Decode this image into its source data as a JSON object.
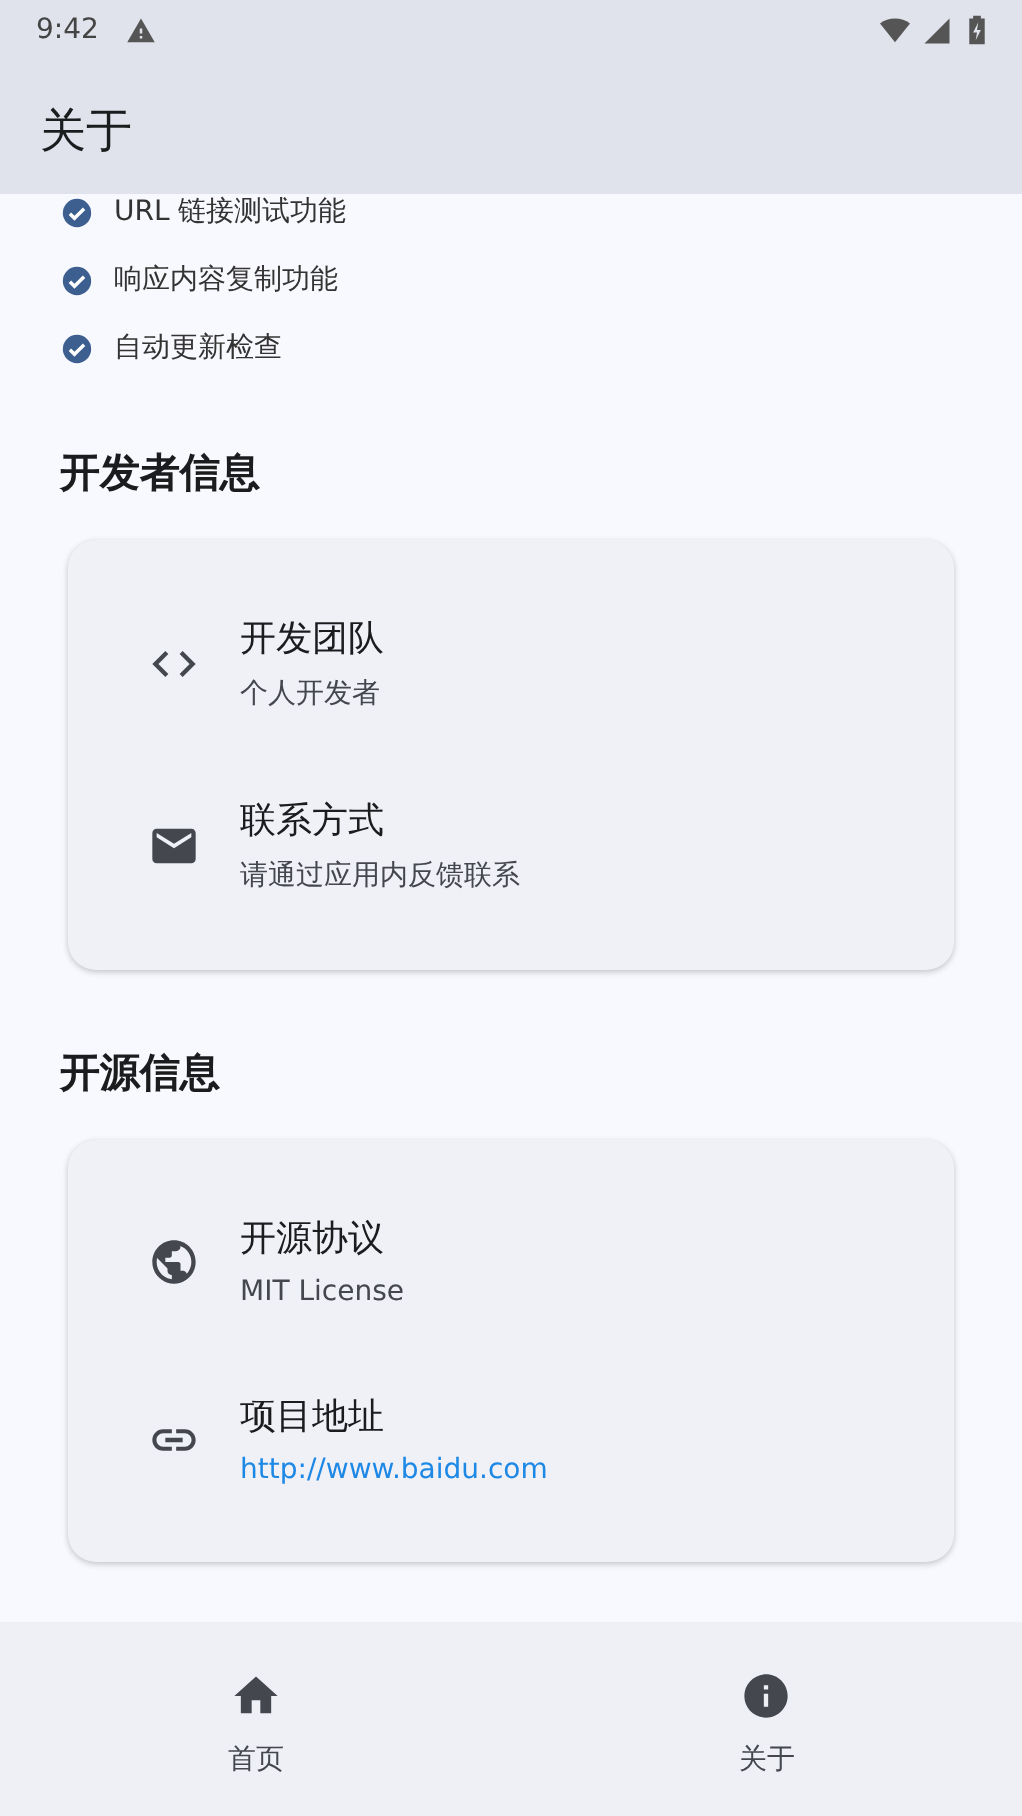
{
  "status_bar": {
    "time": "9:42"
  },
  "app_bar": {
    "title": "关于"
  },
  "features": [
    {
      "label": "URL 链接测试功能",
      "checked": true
    },
    {
      "label": "响应内容复制功能",
      "checked": true
    },
    {
      "label": "自动更新检查",
      "checked": true
    }
  ],
  "sections": [
    {
      "heading": "开发者信息",
      "items": [
        {
          "kind": "code",
          "title": "开发团队",
          "subtitle": "个人开发者",
          "link": false
        },
        {
          "kind": "mail",
          "title": "联系方式",
          "subtitle": "请通过应用内反馈联系",
          "link": false
        }
      ]
    },
    {
      "heading": "开源信息",
      "items": [
        {
          "kind": "globe",
          "title": "开源协议",
          "subtitle": "MIT License",
          "link": false
        },
        {
          "kind": "link",
          "title": "项目地址",
          "subtitle": "http://www.baidu.com",
          "link": true
        }
      ]
    }
  ],
  "bottom_nav": [
    {
      "kind": "home",
      "label": "首页"
    },
    {
      "kind": "info",
      "label": "关于"
    }
  ]
}
